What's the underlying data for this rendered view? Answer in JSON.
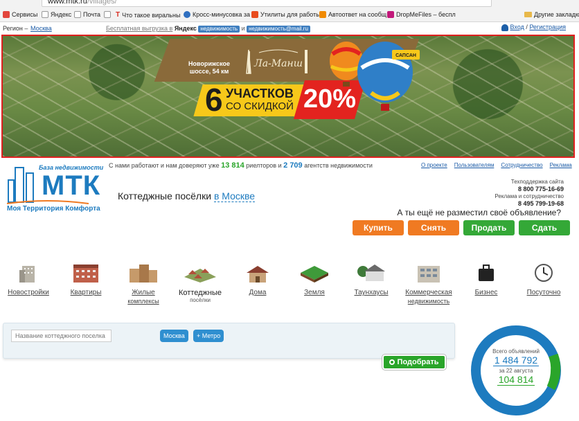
{
  "browser": {
    "url_host": "www.mtk.ru",
    "url_path": "/villages/",
    "bookmarks": [
      {
        "label": "Сервисы",
        "color": "#e2453c"
      },
      {
        "label": "Яндекс",
        "color": "#ffffff"
      },
      {
        "label": "Почта",
        "color": "#ffffff"
      },
      {
        "label": "",
        "color": "#ffffff"
      },
      {
        "label": "Что такое виральны",
        "color": "#d93025"
      },
      {
        "label": "Кросс-минусовка за",
        "color": "#2f6fc0"
      },
      {
        "label": "Утилиты для работы",
        "color": "#e84c1e"
      },
      {
        "label": "Автоответ на сообщ",
        "color": "#f08a00"
      },
      {
        "label": "DropMeFiles – беспл",
        "color": "#c2187a"
      }
    ],
    "other_bookmarks": "Другие закладки"
  },
  "topbar": {
    "region_label": "Регион –",
    "region_value": "Москва",
    "free_export": "Бесплатная выгрузка в",
    "yandex": "Яндекс",
    "yandex_badge": "недвижимость",
    "and": "и",
    "mail_badge": "недвижимость@mail.ru",
    "login": "Вход",
    "slash": "/",
    "register": "Регистрация"
  },
  "banner": {
    "location": "Новорижское шоссе, 54 км",
    "brand": "Ла-Манш",
    "number": "6",
    "line1": "УЧАСТКОВ",
    "line2": "СО СКИДКОЙ",
    "percent": "20%",
    "balloon_brand": "САПСАН"
  },
  "logo": {
    "tagline": "База недвижимости",
    "letters": "МТК",
    "slogan": "Моя Территория Комфорта"
  },
  "trust": {
    "prefix": "С нами работают и нам доверяют уже",
    "realtors_count": "13 814",
    "realtors_text": "риелторов и",
    "agencies_count": "2 709",
    "agencies_text": "агентств недвижимости"
  },
  "toplinks": [
    "О проекте",
    "Пользователям",
    "Сотрудничество",
    "Реклама"
  ],
  "heading": {
    "text": "Коттеджные посёлки",
    "city": "в Москве"
  },
  "contacts": {
    "support_label": "Техподдержка сайта",
    "support_phone": "8 800 775-16-69",
    "ads_label": "Реклама и сотрудничество",
    "ads_phone": "8 495 799-19-68"
  },
  "placed_question": "А ты ещё не разместил своё объявление?",
  "actions": [
    "Купить",
    "Снять",
    "Продать",
    "Сдать"
  ],
  "categories": [
    {
      "label": "Новостройки",
      "sub": ""
    },
    {
      "label": "Квартиры",
      "sub": ""
    },
    {
      "label": "Жилые",
      "sub": "комплексы"
    },
    {
      "label": "Коттеджные",
      "sub": "посёлки"
    },
    {
      "label": "Дома",
      "sub": ""
    },
    {
      "label": "Земля",
      "sub": ""
    },
    {
      "label": "Таунхаусы",
      "sub": ""
    },
    {
      "label": "Коммерческая",
      "sub": "недвижимость"
    },
    {
      "label": "Бизнес",
      "sub": ""
    },
    {
      "label": "Посуточно",
      "sub": ""
    }
  ],
  "search": {
    "placeholder": "Название коттеджного поселка",
    "city_chip": "Москва",
    "metro_chip": "+ Метро",
    "find_button": "Подобрать"
  },
  "stats": {
    "total_label": "Всего объявлений",
    "total_value": "1 484 792",
    "date_label": "за 22 августа",
    "date_value": "104 814",
    "ring_blue": "#1d7bbf",
    "ring_green": "#2aa52a"
  }
}
